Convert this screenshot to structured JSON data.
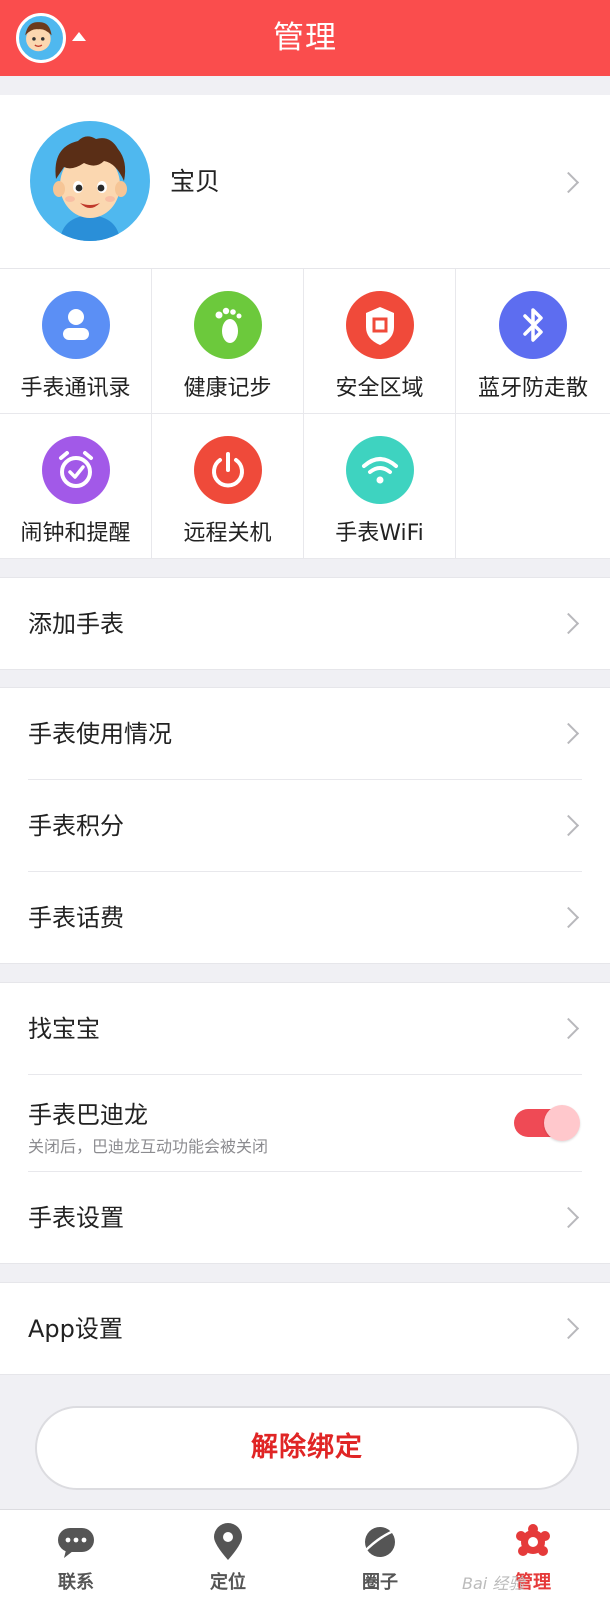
{
  "header": {
    "title": "管理"
  },
  "profile": {
    "name": "宝贝"
  },
  "features": [
    {
      "label": "手表通讯录",
      "icon": "contacts-icon",
      "color": "#5b8ff5"
    },
    {
      "label": "健康记步",
      "icon": "footprint-icon",
      "color": "#6cc93c"
    },
    {
      "label": "安全区域",
      "icon": "shield-icon",
      "color": "#f04a3a"
    },
    {
      "label": "蓝牙防走散",
      "icon": "bluetooth-icon",
      "color": "#5d6df0"
    },
    {
      "label": "闹钟和提醒",
      "icon": "alarm-clock-icon",
      "color": "#a259e8"
    },
    {
      "label": "远程关机",
      "icon": "power-icon",
      "color": "#ef4a3a"
    },
    {
      "label": "手表WiFi",
      "icon": "wifi-icon",
      "color": "#3ed3c0"
    }
  ],
  "menu": {
    "add_watch": "添加手表",
    "usage": "手表使用情况",
    "points": "手表积分",
    "billing": "手表话费",
    "find_baby": "找宝宝",
    "badilong": {
      "label": "手表巴迪龙",
      "sub": "关闭后，巴迪龙互动功能会被关闭",
      "enabled": true
    },
    "watch_settings": "手表设置",
    "app_settings": "App设置"
  },
  "unbind_label": "解除绑定",
  "tabs": [
    {
      "label": "联系",
      "icon": "chat-bubble-icon"
    },
    {
      "label": "定位",
      "icon": "location-pin-icon"
    },
    {
      "label": "圈子",
      "icon": "planet-icon"
    },
    {
      "label": "管理",
      "icon": "manage-icon",
      "active": true
    }
  ],
  "watermark": "Bai 经验"
}
